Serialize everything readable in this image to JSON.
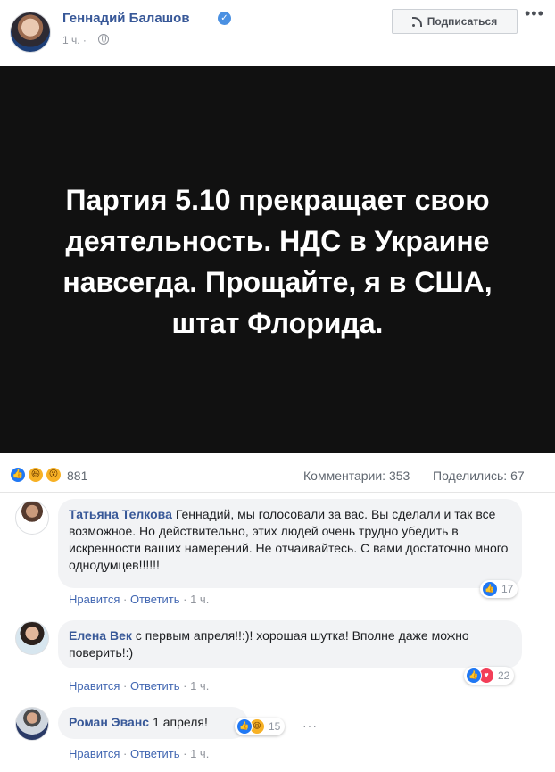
{
  "post": {
    "author": "Геннадий Балашов",
    "time": "1 ч. ·",
    "subscribe_label": "Подписаться",
    "more_label": "•••",
    "image_text": "Партия 5.10 прекращает свою деятельность. НДС в Украине навсегда. Прощайте, я в США, штат Флорида."
  },
  "stats": {
    "reactions_count": "881",
    "reaction_types": [
      "like-icon",
      "haha-icon",
      "wow-icon"
    ],
    "comments": "Комментарии: 353",
    "shares": "Поделились: 67"
  },
  "comments": [
    {
      "author": "Татьяна Телкова",
      "text": "Геннадий, мы голосовали за вас. Вы сделали и так все возможное. Но действительно, этих людей очень трудно убедить в искренности ваших намерений. Не отчаивайтесь. С вами достаточно много однодумцев!!!!!!",
      "like": "Нравится",
      "reply": "Ответить",
      "time": "1 ч.",
      "reactions": "17"
    },
    {
      "author": "Елена Век",
      "text": "с первым апреля!!:)! хорошая шутка! Вполне даже можно поверить!:)",
      "like": "Нравится",
      "reply": "Ответить",
      "time": "1 ч.",
      "reactions": "22"
    },
    {
      "author": "Роман Эванс",
      "text": "1 апреля!",
      "like": "Нравится",
      "reply": "Ответить",
      "time": "1 ч.",
      "reactions": "15",
      "more": "···"
    }
  ],
  "colors": {
    "link": "#385898",
    "like": "#2078f4",
    "haha": "#f7b125",
    "love": "#f33e58",
    "image_bg": "#111111"
  }
}
